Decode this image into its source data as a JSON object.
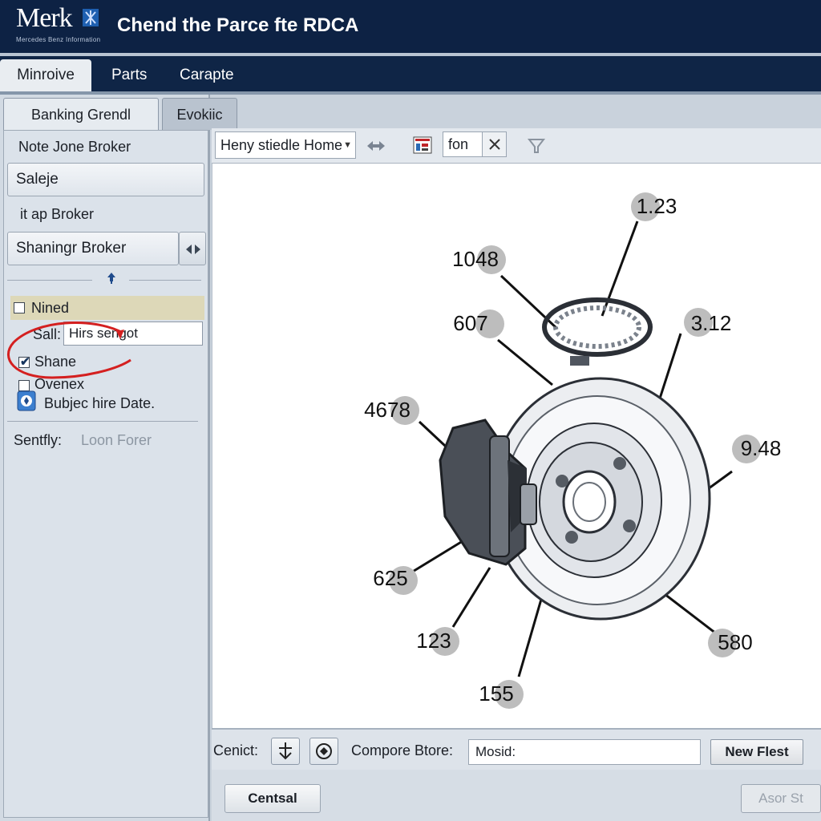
{
  "header": {
    "logo_text": "Merk",
    "logo_tagline": "Mercedes Benz Information",
    "title": "Chend the Parce fte RDCA"
  },
  "main_tabs": [
    {
      "label": "Minroive",
      "active": true
    },
    {
      "label": "Parts",
      "active": false
    },
    {
      "label": "Carapte",
      "active": false
    }
  ],
  "sidebar": {
    "tabs": [
      {
        "label": "Banking Grendl",
        "active": true
      },
      {
        "label": "Evokiic",
        "active": false
      }
    ],
    "items": [
      {
        "label": "Note Jone Broker",
        "type": "text"
      },
      {
        "label": "Saleje",
        "type": "button"
      },
      {
        "label": "it ap Broker",
        "type": "text"
      },
      {
        "label": "Shaningr Broker",
        "type": "button"
      }
    ],
    "filters": {
      "nined": {
        "label": "Nined",
        "checked": false
      },
      "sall_label": "Sall:",
      "sall_value": "Hirs sengot",
      "shane": {
        "label": "Shane",
        "checked": true
      },
      "ovenex": {
        "label": "Ovenex",
        "checked": false
      },
      "subject_label": "Bubjec hire Date."
    },
    "status_label": "Sentfly:",
    "status_value": "Loon Forer"
  },
  "toolbar": {
    "dropdown_value": "Heny stiedle Home",
    "search_value": "fon"
  },
  "diagram": {
    "callouts": [
      "1.23",
      "1048",
      "607",
      "3.12",
      "4678",
      "9.48",
      "625",
      "123",
      "155",
      "580"
    ]
  },
  "bottom_bar": {
    "label": "Cenict:",
    "compare_label": "Compore Btore:",
    "compare_value": "Mosid:",
    "button_label": "New Flest"
  },
  "footer": {
    "left_button": "Centsal",
    "right_button": "Asor St"
  },
  "colors": {
    "header_bg": "#0d2244",
    "annotation_red": "#d42020",
    "checkbox_check": "#16355e"
  }
}
